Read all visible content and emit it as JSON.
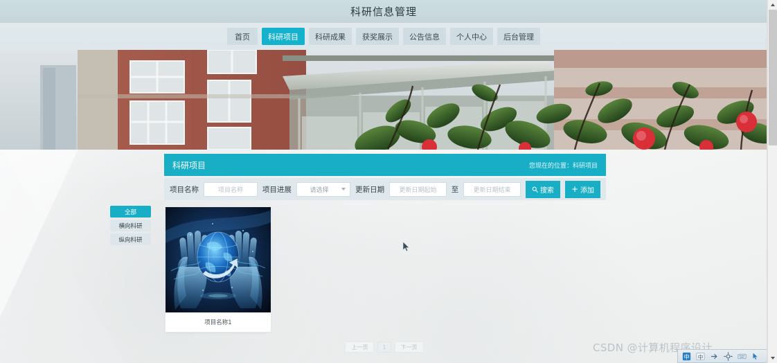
{
  "header": {
    "title": "科研信息管理"
  },
  "nav": {
    "items": [
      {
        "label": "首页",
        "active": false
      },
      {
        "label": "科研项目",
        "active": true
      },
      {
        "label": "科研成果",
        "active": false
      },
      {
        "label": "获奖展示",
        "active": false
      },
      {
        "label": "公告信息",
        "active": false
      },
      {
        "label": "个人中心",
        "active": false
      },
      {
        "label": "后台管理",
        "active": false
      }
    ]
  },
  "banner": {
    "alt": "校园教学楼与茶花",
    "colors": {
      "brick": "#a8584a",
      "foliage": "#3e6b2e",
      "flower": "#e23b46",
      "sky": "#dfe7ec"
    }
  },
  "panel": {
    "title": "科研项目",
    "breadcrumb": "您现在的位置：科研项目"
  },
  "filter": {
    "name_label": "项目名称",
    "name_placeholder": "项目名称",
    "progress_label": "项目进展",
    "progress_selected": "请选择",
    "progress_options": [
      "请选择"
    ],
    "date_label": "更新日期",
    "date_start_placeholder": "更新日期起始",
    "date_separator": "至",
    "date_end_placeholder": "更新日期结束",
    "search_label": "搜索",
    "add_label": "添加"
  },
  "categories": [
    {
      "label": "全部",
      "active": true
    },
    {
      "label": "横向科研",
      "active": false
    },
    {
      "label": "纵向科研",
      "active": false
    }
  ],
  "cards": [
    {
      "title": "项目名称1"
    }
  ],
  "pagination": {
    "prev": "上一页",
    "current": "1",
    "next": "下一页"
  },
  "watermark": {
    "text": "CSDN @计算机程序设计"
  },
  "colors": {
    "accent": "#17aec6",
    "nav_bg": "#dde6ea",
    "title_bg": "#c9d9de",
    "filter_bg": "#dfe8ec",
    "page_bg": "#f4f5f5"
  }
}
